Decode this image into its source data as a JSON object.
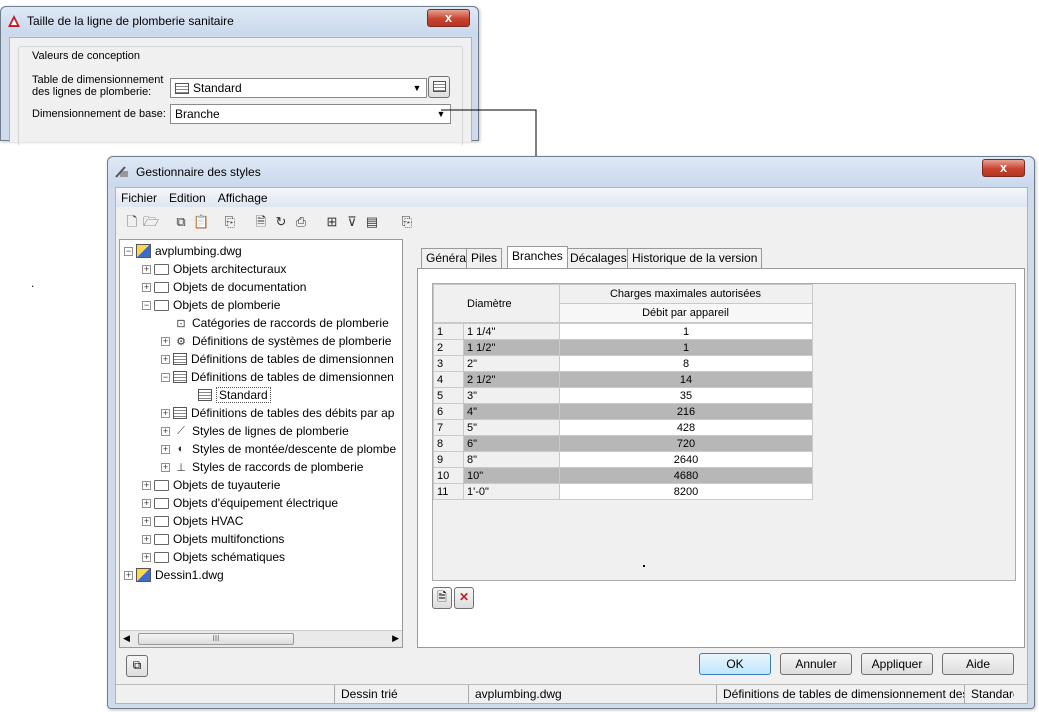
{
  "dialog1": {
    "title": "Taille de la ligne de plomberie sanitaire",
    "group_label": "Valeurs de conception",
    "table_label_line1": "Table de dimensionnement",
    "table_label_line2": "des lignes de plomberie:",
    "table_value": "Standard",
    "base_label": "Dimensionnement de base:",
    "base_value": "Branche",
    "close_label": "x"
  },
  "stray_dot": ".",
  "manager": {
    "title": "Gestionnaire des styles",
    "close_label": "x",
    "menu": [
      "Fichier",
      "Edition",
      "Affichage"
    ],
    "tree": {
      "root1": "avplumbing.dwg",
      "objets_arch": "Objets architecturaux",
      "objets_doc": "Objets de documentation",
      "objets_plomb": "Objets de plomberie",
      "cat_raccords": "Catégories de raccords de plomberie",
      "def_systemes": "Définitions de systèmes de plomberie",
      "def_tables1": "Définitions de tables de dimensionnen",
      "def_tables2": "Définitions de tables de dimensionnen",
      "standard": "Standard",
      "def_debits": "Définitions de tables des débits par ap",
      "styles_lignes": "Styles de lignes de plomberie",
      "styles_montee": "Styles de montée/descente de plombe",
      "styles_raccords": "Styles de raccords de plomberie",
      "objets_tuyau": "Objets de tuyauterie",
      "objets_elec": "Objets d'équipement électrique",
      "objets_hvac": "Objets HVAC",
      "objets_multi": "Objets multifonctions",
      "objets_schema": "Objets schématiques",
      "root2": "Dessin1.dwg"
    },
    "scroll_mark": "III",
    "tabs": [
      "Général",
      "Piles",
      "Branches",
      "Décalages",
      "Historique de la version"
    ],
    "table": {
      "header_diam": "Diamètre",
      "header_charges": "Charges maximales autorisées",
      "header_debit": "Débit par appareil",
      "rows": [
        {
          "n": "1",
          "d": "1 1/4\"",
          "v": "1"
        },
        {
          "n": "2",
          "d": "1 1/2\"",
          "v": "1"
        },
        {
          "n": "3",
          "d": "2\"",
          "v": "8"
        },
        {
          "n": "4",
          "d": "2 1/2\"",
          "v": "14"
        },
        {
          "n": "5",
          "d": "3\"",
          "v": "35"
        },
        {
          "n": "6",
          "d": "4\"",
          "v": "216"
        },
        {
          "n": "7",
          "d": "5\"",
          "v": "428"
        },
        {
          "n": "8",
          "d": "6\"",
          "v": "720"
        },
        {
          "n": "9",
          "d": "8\"",
          "v": "2640"
        },
        {
          "n": "10",
          "d": "10\"",
          "v": "4680"
        },
        {
          "n": "11",
          "d": "1'-0\"",
          "v": "8200"
        }
      ]
    },
    "buttons": {
      "ok": "OK",
      "cancel": "Annuler",
      "apply": "Appliquer",
      "help": "Aide"
    },
    "status": {
      "sort": "Dessin trié",
      "file": "avplumbing.dwg",
      "def": "Définitions de tables de dimensionnement des",
      "std": "Standard"
    }
  }
}
